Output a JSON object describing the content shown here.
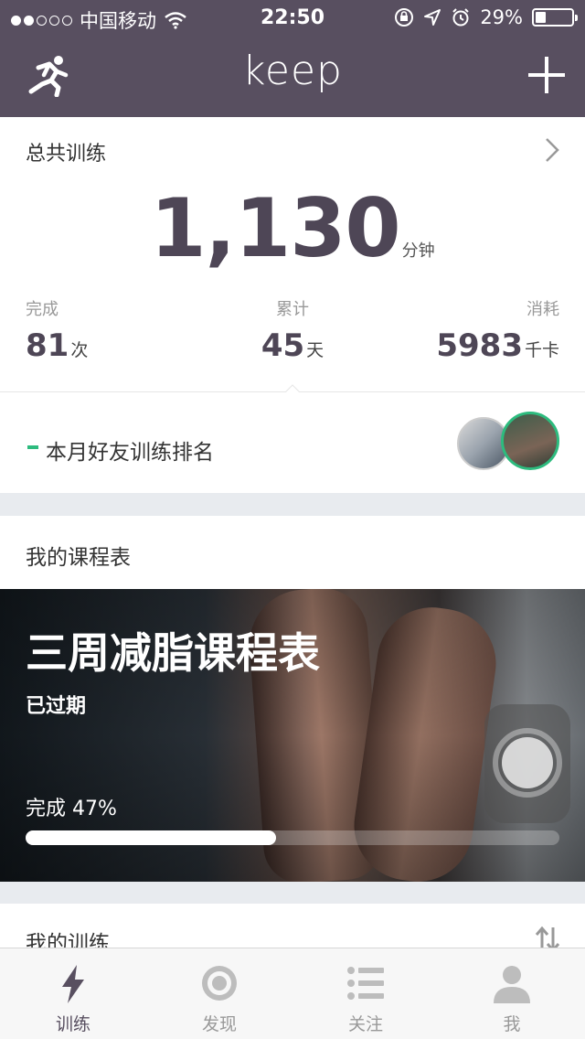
{
  "status_bar": {
    "carrier": "中国移动",
    "time": "22:50",
    "battery": "29%",
    "battery_level": 0.29,
    "signal_bars_on": 2,
    "signal_bars_total": 5
  },
  "header": {
    "logo": "keep",
    "left_icon": "runner-icon",
    "right_icon": "plus-icon"
  },
  "summary": {
    "title": "总共训练",
    "total_value": "1,130",
    "total_unit": "分钟",
    "stats": [
      {
        "label": "完成",
        "value": "81",
        "unit": "次"
      },
      {
        "label": "累计",
        "value": "45",
        "unit": "天"
      },
      {
        "label": "消耗",
        "value": "5983",
        "unit": "千卡"
      }
    ]
  },
  "ranking": {
    "label": "本月好友训练排名"
  },
  "schedule": {
    "section_title": "我的课程表",
    "course_title": "三周减脂课程表",
    "course_status": "已过期",
    "progress_label": "完成 47%",
    "progress": 0.47
  },
  "my_training": {
    "title": "我的训练"
  },
  "tabbar": {
    "tabs": [
      {
        "label": "训练",
        "icon": "lightning-icon",
        "active": true
      },
      {
        "label": "发现",
        "icon": "target-icon",
        "active": false
      },
      {
        "label": "关注",
        "icon": "list-icon",
        "active": false
      },
      {
        "label": "我",
        "icon": "person-icon",
        "active": false
      }
    ]
  },
  "colors": {
    "header_bg": "#584f60",
    "accent_green": "#2dbb7e",
    "number_color": "#4e4656"
  }
}
